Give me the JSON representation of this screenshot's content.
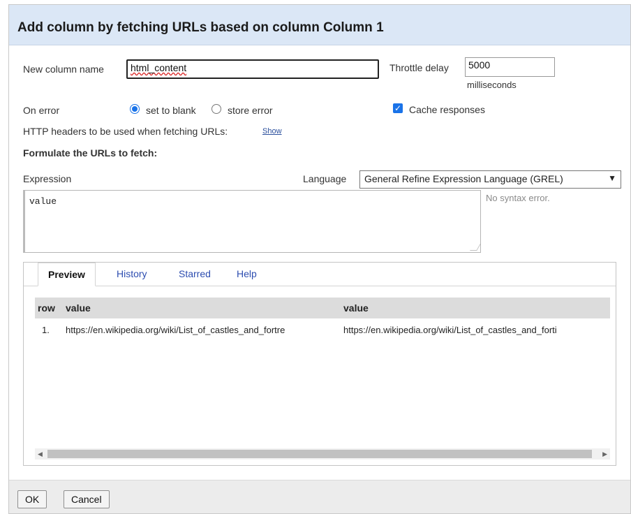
{
  "dialog": {
    "title": "Add column by fetching URLs based on column Column 1"
  },
  "form": {
    "new_column_label": "New column name",
    "new_column_value": "html_content",
    "throttle_label": "Throttle delay",
    "throttle_value": "5000",
    "throttle_unit": "milliseconds",
    "on_error_label": "On error",
    "on_error_options": [
      "set to blank",
      "store error"
    ],
    "on_error_selected": "set to blank",
    "cache_label": "Cache responses",
    "cache_checked": true,
    "headers_label": "HTTP headers to be used when fetching URLs:",
    "headers_show_link": "Show",
    "formulate_label": "Formulate the URLs to fetch:",
    "expression_label": "Expression",
    "language_label": "Language",
    "language_value": "General Refine Expression Language (GREL)",
    "expression_value": "value",
    "syntax_status": "No syntax error."
  },
  "tabs": [
    "Preview",
    "History",
    "Starred",
    "Help"
  ],
  "active_tab": "Preview",
  "preview": {
    "headers": [
      "row",
      "value",
      "value"
    ],
    "rows": [
      [
        "1.",
        "https://en.wikipedia.org/wiki/List_of_castles_and_fortre",
        "https://en.wikipedia.org/wiki/List_of_castles_and_forti"
      ]
    ]
  },
  "footer": {
    "ok": "OK",
    "cancel": "Cancel"
  },
  "colors": {
    "header_bg": "#dbe7f6",
    "accent": "#1a73e8",
    "link": "#2d4db0"
  },
  "icons": [
    "radio-checked-icon",
    "radio-unchecked-icon",
    "checkbox-checked-icon",
    "chevron-down-icon",
    "resize-grip-icon",
    "scroll-left-icon",
    "scroll-right-icon"
  ]
}
